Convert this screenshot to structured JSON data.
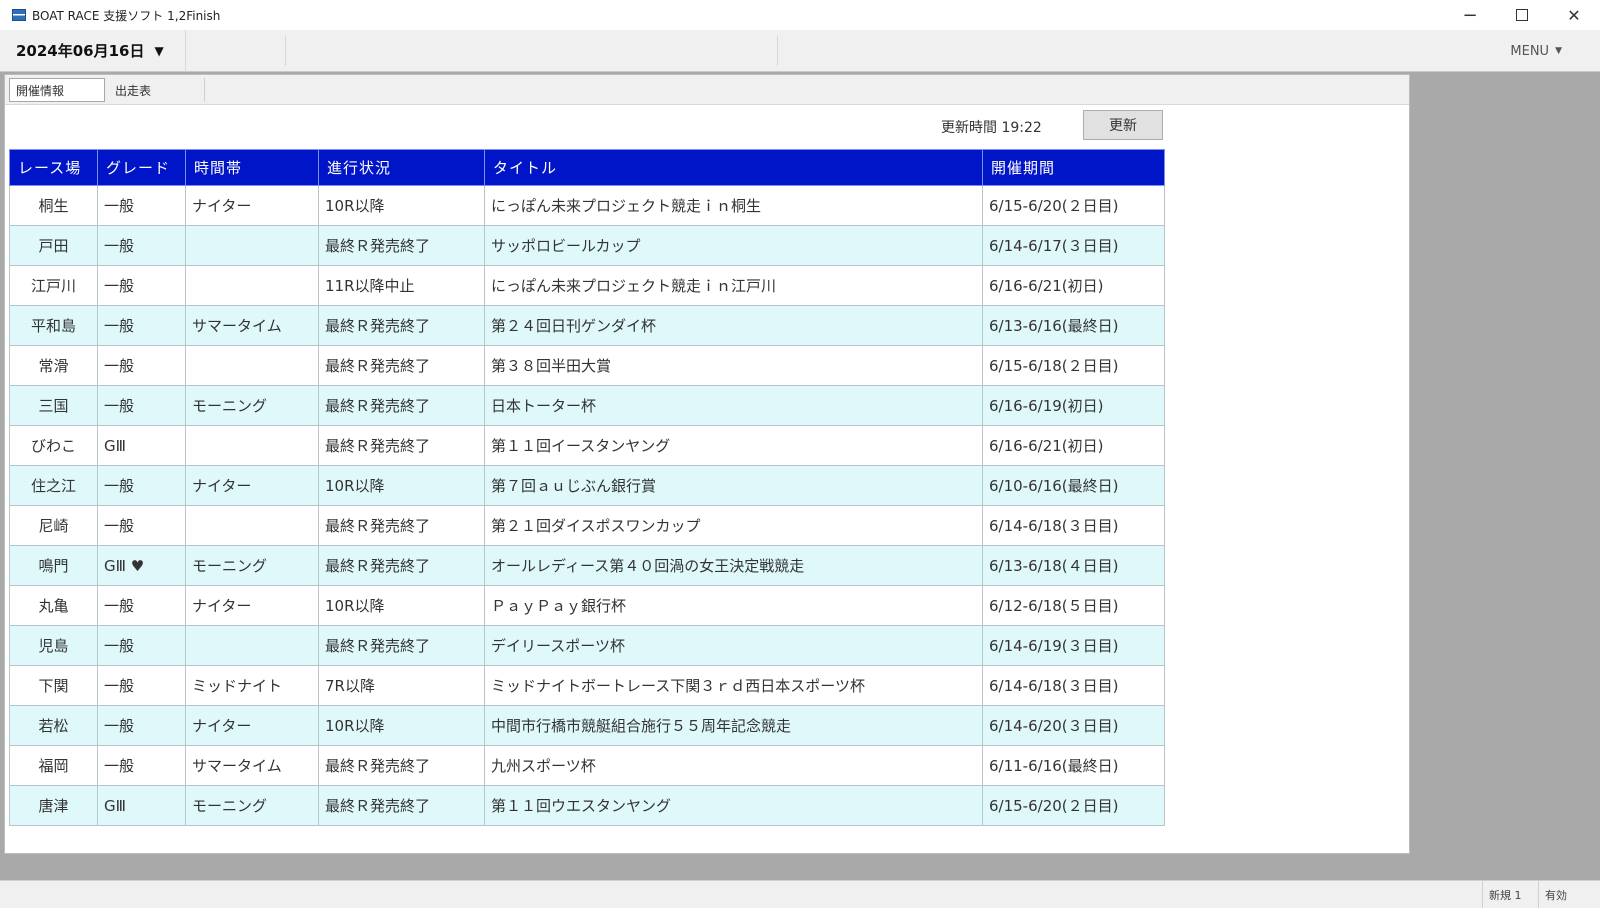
{
  "window": {
    "title": "BOAT RACE 支援ソフト 1,2Finish",
    "icon": "app-icon",
    "minimize_glyph": "−",
    "close_glyph": "✕"
  },
  "toolbar": {
    "date": "2024年06月16日",
    "date_arrow": "▼",
    "menu_label": "MENU",
    "menu_caret": "▼"
  },
  "tabs": [
    {
      "label": "開催情報"
    },
    {
      "label": "出走表"
    }
  ],
  "update": {
    "time_text": "更新時間 19:22",
    "button_label": "更新"
  },
  "table": {
    "headers": [
      "レース場",
      "グレード",
      "時間帯",
      "進行状況",
      "タイトル",
      "開催期間"
    ],
    "rows": [
      {
        "venue": "桐生",
        "grade": "一般",
        "time": "ナイター",
        "status": "10R以降",
        "title": "にっぽん未来プロジェクト競走ｉｎ桐生",
        "period": "6/15-6/20(２日目)"
      },
      {
        "venue": "戸田",
        "grade": "一般",
        "time": "",
        "status": "最終Ｒ発売終了",
        "title": "サッポロビールカップ",
        "period": "6/14-6/17(３日目)"
      },
      {
        "venue": "江戸川",
        "grade": "一般",
        "time": "",
        "status": "11R以降中止",
        "title": "にっぽん未来プロジェクト競走ｉｎ江戸川",
        "period": "6/16-6/21(初日)"
      },
      {
        "venue": "平和島",
        "grade": "一般",
        "time": "サマータイム",
        "status": "最終Ｒ発売終了",
        "title": "第２４回日刊ゲンダイ杯",
        "period": "6/13-6/16(最終日)"
      },
      {
        "venue": "常滑",
        "grade": "一般",
        "time": "",
        "status": "最終Ｒ発売終了",
        "title": "第３８回半田大賞",
        "period": "6/15-6/18(２日目)"
      },
      {
        "venue": "三国",
        "grade": "一般",
        "time": "モーニング",
        "status": "最終Ｒ発売終了",
        "title": "日本トーター杯",
        "period": "6/16-6/19(初日)"
      },
      {
        "venue": "びわこ",
        "grade": "GⅢ",
        "time": "",
        "status": "最終Ｒ発売終了",
        "title": "第１１回イースタンヤング",
        "period": "6/16-6/21(初日)"
      },
      {
        "venue": "住之江",
        "grade": "一般",
        "time": "ナイター",
        "status": "10R以降",
        "title": "第７回ａｕじぶん銀行賞",
        "period": "6/10-6/16(最終日)"
      },
      {
        "venue": "尼崎",
        "grade": "一般",
        "time": "",
        "status": "最終Ｒ発売終了",
        "title": "第２１回ダイスポスワンカップ",
        "period": "6/14-6/18(３日目)"
      },
      {
        "venue": "鳴門",
        "grade": "GⅢ ♥",
        "time": "モーニング",
        "status": "最終Ｒ発売終了",
        "title": "オールレディース第４０回渦の女王決定戦競走",
        "period": "6/13-6/18(４日目)"
      },
      {
        "venue": "丸亀",
        "grade": "一般",
        "time": "ナイター",
        "status": "10R以降",
        "title": "ＰａｙＰａｙ銀行杯",
        "period": "6/12-6/18(５日目)"
      },
      {
        "venue": "児島",
        "grade": "一般",
        "time": "",
        "status": "最終Ｒ発売終了",
        "title": "デイリースポーツ杯",
        "period": "6/14-6/19(３日目)"
      },
      {
        "venue": "下関",
        "grade": "一般",
        "time": "ミッドナイト",
        "status": "7R以降",
        "title": "ミッドナイトボートレース下関３ｒｄ西日本スポーツ杯",
        "period": "6/14-6/18(３日目)"
      },
      {
        "venue": "若松",
        "grade": "一般",
        "time": "ナイター",
        "status": "10R以降",
        "title": "中間市行橋市競艇組合施行５５周年記念競走",
        "period": "6/14-6/20(３日目)"
      },
      {
        "venue": "福岡",
        "grade": "一般",
        "time": "サマータイム",
        "status": "最終Ｒ発売終了",
        "title": "九州スポーツ杯",
        "period": "6/11-6/16(最終日)"
      },
      {
        "venue": "唐津",
        "grade": "GⅢ",
        "time": "モーニング",
        "status": "最終Ｒ発売終了",
        "title": "第１１回ウエスタンヤング",
        "period": "6/15-6/20(２日目)"
      }
    ]
  },
  "statusbar": {
    "left_text": "新規 1",
    "right_text": "有効"
  },
  "colors": {
    "header_bg": "#0015c7",
    "row_alt_bg": "#dff9fb",
    "outer_bg": "#a9a9a9"
  }
}
